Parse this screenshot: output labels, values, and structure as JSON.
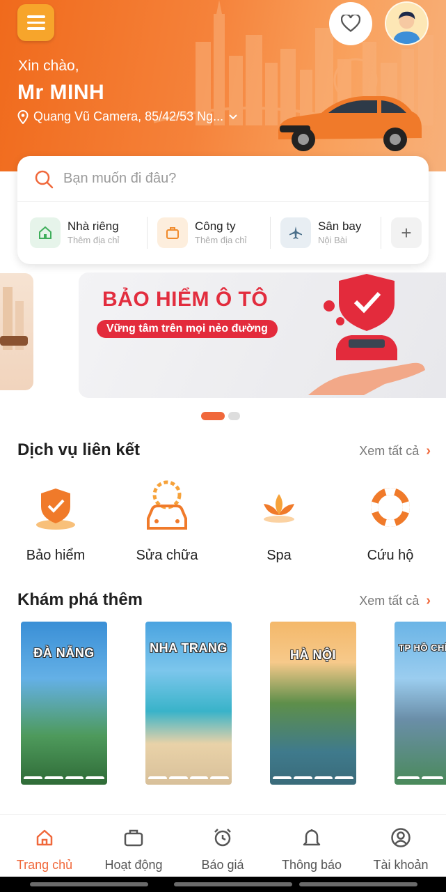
{
  "header": {
    "greeting": "Xin chào,",
    "user_name": "Mr MINH",
    "location": "Quang Vũ Camera, 85/42/53 Ng..."
  },
  "search": {
    "placeholder": "Bạn muốn đi đâu?",
    "quick_places": [
      {
        "title": "Nhà riêng",
        "subtitle": "Thêm địa chỉ",
        "icon": "home-icon",
        "color": "#3fae5b"
      },
      {
        "title": "Công ty",
        "subtitle": "Thêm địa chỉ",
        "icon": "briefcase-icon",
        "color": "#f08a2a"
      },
      {
        "title": "Sân bay",
        "subtitle": "Nội Bài",
        "icon": "airplane-icon",
        "color": "#4a6f8a"
      }
    ],
    "add_label": "+"
  },
  "banner": {
    "title": "BẢO HIỂM Ô TÔ",
    "tagline": "Vững tâm trên mọi nẻo đường"
  },
  "services": {
    "title": "Dịch vụ liên kết",
    "see_all": "Xem tất cả",
    "items": [
      {
        "label": "Bảo hiểm",
        "icon": "shield-icon"
      },
      {
        "label": "Sửa chữa",
        "icon": "car-repair-icon"
      },
      {
        "label": "Spa",
        "icon": "lotus-icon"
      },
      {
        "label": "Cứu hộ",
        "icon": "lifebuoy-icon"
      }
    ]
  },
  "explore": {
    "title": "Khám phá thêm",
    "see_all": "Xem tất cả",
    "destinations": [
      {
        "name": "ĐÀ NẴNG"
      },
      {
        "name": "NHA TRANG"
      },
      {
        "name": "HÀ NỘI"
      },
      {
        "name": "TP HỒ CHÍ MINH"
      }
    ]
  },
  "nav": {
    "items": [
      {
        "label": "Trang chủ",
        "icon": "home-icon",
        "active": true
      },
      {
        "label": "Hoạt động",
        "icon": "briefcase-icon"
      },
      {
        "label": "Báo giá",
        "icon": "alarm-clock-icon"
      },
      {
        "label": "Thông báo",
        "icon": "bell-icon"
      },
      {
        "label": "Tài khoản",
        "icon": "user-circle-icon"
      }
    ]
  },
  "colors": {
    "accent": "#f0683b",
    "header_start": "#f06a1c",
    "banner_red": "#e22d3e"
  }
}
